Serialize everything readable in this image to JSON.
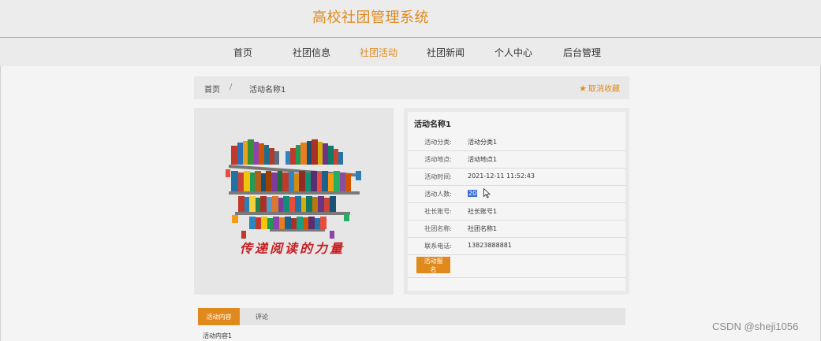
{
  "header": {
    "site_title": "高校社团管理系统"
  },
  "nav": {
    "items": [
      {
        "label": "首页"
      },
      {
        "label": "社团信息"
      },
      {
        "label": "社团活动"
      },
      {
        "label": "社团新闻"
      },
      {
        "label": "个人中心"
      },
      {
        "label": "后台管理"
      }
    ],
    "active_index": 2
  },
  "breadcrumb": {
    "home": "首页",
    "separator": "/",
    "current": "活动名称1",
    "favorite_label": "取消收藏",
    "favorite_icon": "star-icon"
  },
  "image": {
    "slogan": "传递阅读的力量",
    "slogan_color": "#c62024"
  },
  "details": {
    "title": "活动名称1",
    "rows": [
      {
        "label": "活动分类:",
        "value": "活动分类1"
      },
      {
        "label": "活动地点:",
        "value": "活动地点1"
      },
      {
        "label": "活动时间:",
        "value": "2021-12-11 11:52:43"
      },
      {
        "label": "活动人数:",
        "value": "20"
      },
      {
        "label": "社长账号:",
        "value": "社长账号1"
      },
      {
        "label": "社团名称:",
        "value": "社团名称1"
      },
      {
        "label": "联系电话:",
        "value": "13823888881"
      }
    ],
    "signup_button": "活动报名"
  },
  "tabs": {
    "items": [
      {
        "label": "活动内容"
      },
      {
        "label": "评论"
      }
    ],
    "active_index": 0,
    "content_text": "活动内容1"
  },
  "watermark": "CSDN @sheji1056",
  "colors": {
    "accent": "#e08a1e",
    "selection": "#3b6fd6"
  }
}
